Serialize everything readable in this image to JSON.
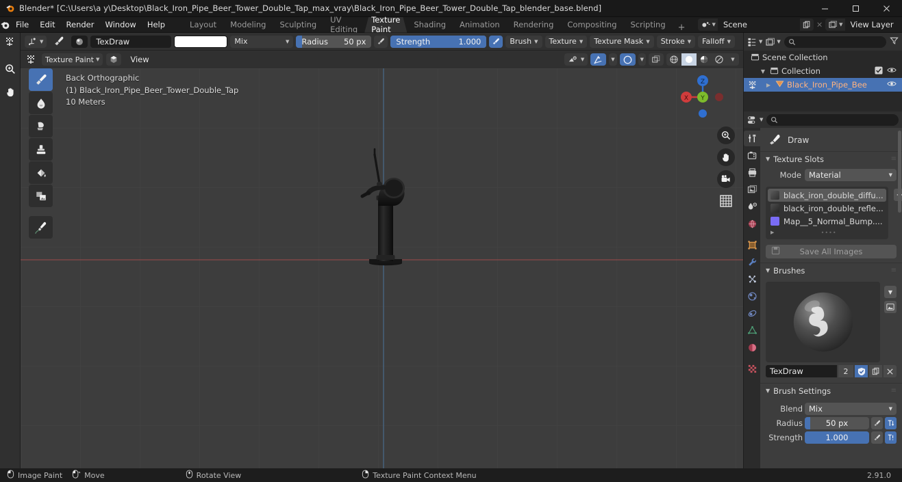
{
  "titlebar": {
    "title": "Blender* [C:\\Users\\a y\\Desktop\\Black_Iron_Pipe_Beer_Tower_Double_Tap_max_vray\\Black_Iron_Pipe_Beer_Tower_Double_Tap_blender_base.blend]",
    "minimize": "–",
    "maximize": "❐",
    "close": "✕"
  },
  "topbar": {
    "menus": [
      "File",
      "Edit",
      "Render",
      "Window",
      "Help"
    ],
    "workspaces": [
      "Layout",
      "Modeling",
      "Sculpting",
      "UV Editing",
      "Texture Paint",
      "Shading",
      "Animation",
      "Rendering",
      "Compositing",
      "Scripting"
    ],
    "active_workspace": "Texture Paint",
    "add_workspace": "+",
    "scene_name": "Scene",
    "view_layer_name": "View Layer"
  },
  "tool_header": {
    "brush_name": "TexDraw",
    "color_swatch": "#ffffff",
    "blend_mode": "Mix",
    "radius_label": "Radius",
    "radius_value": "50 px",
    "radius_fill_pct": 8,
    "strength_label": "Strength",
    "strength_value": "1.000",
    "strength_fill_pct": 100,
    "popovers": [
      "Brush",
      "Texture",
      "Texture Mask",
      "Stroke",
      "Falloff"
    ]
  },
  "viewport_header": {
    "mode": "Texture Paint",
    "view_menu": "View"
  },
  "viewport": {
    "overlay_line1": "Back Orthographic",
    "overlay_line2": "(1) Black_Iron_Pipe_Beer_Tower_Double_Tap",
    "overlay_line3": "10 Meters",
    "gizmo_axes": [
      "X",
      "Y",
      "Z"
    ],
    "background_color": "#3d3d3d"
  },
  "outliner": {
    "search_placeholder": "",
    "rows": [
      {
        "name": "Scene Collection",
        "indent": 6,
        "icon": "collection-icon",
        "selected": false,
        "has_disclosure": false,
        "has_checkbox": false,
        "has_eye": false
      },
      {
        "name": "Collection",
        "indent": 20,
        "icon": "collection-icon",
        "selected": false,
        "has_disclosure": true,
        "has_checkbox": true,
        "has_eye": true
      },
      {
        "name": "Black_Iron_Pipe_Bee",
        "indent": 36,
        "icon": "mesh-icon",
        "selected": true,
        "has_disclosure": true,
        "has_checkbox": false,
        "has_eye": true
      }
    ]
  },
  "properties": {
    "search_placeholder": "",
    "brush_title": "Draw",
    "panels": {
      "texture_slots": {
        "title": "Texture Slots",
        "mode_label": "Mode",
        "mode_value": "Material",
        "add_button": "+",
        "slots": [
          {
            "name": "black_iron_double_diffu...",
            "color": "#8a8a8a",
            "selected": true
          },
          {
            "name": "black_iron_double_refle...",
            "color": "#6e6e6e",
            "selected": false
          },
          {
            "name": "Map__5_Normal_Bump....",
            "color": "#7a6cf5",
            "selected": false
          }
        ],
        "save_all_label": "Save All Images"
      },
      "brushes": {
        "title": "Brushes",
        "brush_name": "TexDraw",
        "user_count": "2",
        "fake_user_on": true
      },
      "brush_settings": {
        "title": "Brush Settings",
        "blend_label": "Blend",
        "blend_value": "Mix",
        "radius_label": "Radius",
        "radius_value": "50 px",
        "radius_fill_pct": 8,
        "strength_label": "Strength",
        "strength_value": "1.000",
        "strength_fill_pct": 100
      }
    }
  },
  "statusbar": {
    "items": [
      {
        "icon": "mouse-left-icon",
        "label": "Image Paint"
      },
      {
        "icon": "mouse-move-icon",
        "label": "Move"
      },
      {
        "icon": "mouse-middle-icon",
        "label": "Rotate View"
      },
      {
        "icon": "mouse-right-icon",
        "label": "Texture Paint Context Menu"
      }
    ],
    "version": "2.91.0"
  },
  "left_tools": [
    {
      "name": "draw-tool",
      "active": true
    },
    {
      "name": "soften-tool",
      "active": false
    },
    {
      "name": "smear-tool",
      "active": false
    },
    {
      "name": "clone-tool",
      "active": false
    },
    {
      "name": "fill-tool",
      "active": false
    },
    {
      "name": "mask-tool",
      "active": false
    },
    {
      "name": "annotate-tool",
      "active": false
    }
  ],
  "colors": {
    "accent_blue": "#4772b3",
    "panel_bg": "#303030",
    "editor_bg": "#3d3d3d",
    "window_bg": "#1d1d1d",
    "selected_text_orange": "#ffb380"
  }
}
